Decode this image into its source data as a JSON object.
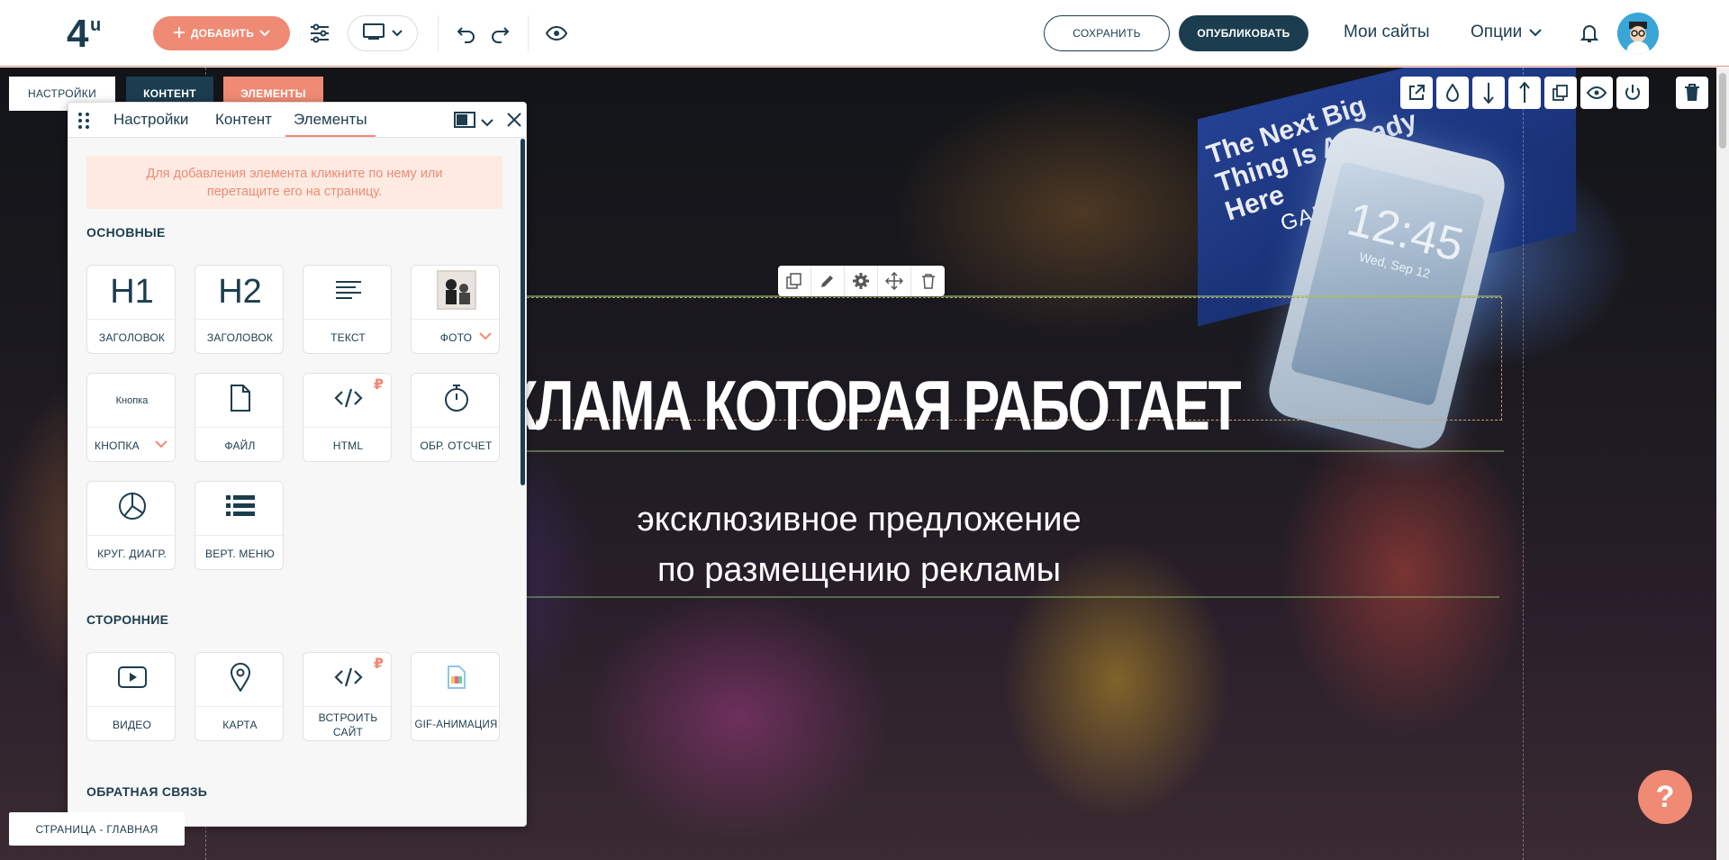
{
  "topbar": {
    "logo_text": "4u",
    "add_label": "ДОБАВИТЬ",
    "save_label": "СОХРАНИТЬ",
    "publish_label": "ОПУБЛИКОВАТЬ",
    "my_sites_label": "Мои сайты",
    "options_label": "Опции",
    "accent_color": "#ef8a74",
    "dark_color": "#1c3d4f"
  },
  "mini_tabs": {
    "settings": "НАСТРОЙКИ",
    "content": "КОНТЕНТ",
    "elements": "ЭЛЕМЕНТЫ"
  },
  "panel": {
    "tabs": [
      "Настройки",
      "Контент",
      "Элементы"
    ],
    "active_tab": "Элементы",
    "info_line1": "Для добавления элемента кликните по нему или",
    "info_line2": "перетащите его на страницу.",
    "sections": {
      "basic": "ОСНОВНЫЕ",
      "third_party": "СТОРОННИЕ",
      "feedback": "ОБРАТНАЯ СВЯЗЬ"
    },
    "basic_items": [
      {
        "icon": "h1-icon",
        "icon_text": "H1",
        "label": "ЗАГОЛОВОК"
      },
      {
        "icon": "h2-icon",
        "icon_text": "H2",
        "label": "ЗАГОЛОВОК"
      },
      {
        "icon": "text-lines-icon",
        "label": "ТЕКСТ"
      },
      {
        "icon": "photo-thumbnail-icon",
        "label": "ФОТО",
        "has_dropdown": true
      },
      {
        "icon": "button-sample-icon",
        "icon_text": "Кнопка",
        "label": "КНОПКА",
        "has_dropdown": true
      },
      {
        "icon": "file-icon",
        "label": "ФАЙЛ"
      },
      {
        "icon": "code-icon",
        "label": "HTML",
        "paid_badge": "₽"
      },
      {
        "icon": "timer-icon",
        "label": "ОБР. ОТСЧЕТ"
      },
      {
        "icon": "pie-chart-icon",
        "label": "КРУГ. ДИАГР."
      },
      {
        "icon": "list-icon",
        "label": "ВЕРТ. МЕНЮ"
      }
    ],
    "third_party_items": [
      {
        "icon": "video-icon",
        "label": "ВИДЕО"
      },
      {
        "icon": "map-pin-icon",
        "label": "КАРТА"
      },
      {
        "icon": "code-icon",
        "label_line1": "ВСТРОИТЬ",
        "label_line2": "САЙТ",
        "paid_badge": "₽"
      },
      {
        "icon": "gif-icon",
        "label": "GIF-АНИМАЦИЯ"
      }
    ]
  },
  "canvas": {
    "headline": "КЛАМА КОТОРАЯ РАБОТАЕТ",
    "subtitle_line1": "эксклюзивное предложение",
    "subtitle_line2": "по размещению рекламы",
    "billboard_text": "The Next Big Thing Is Already Here",
    "phone_brand": "GALAXY SIII",
    "phone_clock": "12:45",
    "phone_date": "Wed, Sep 12"
  },
  "footer": {
    "page_label": "СТРАНИЦА - ГЛАВНАЯ",
    "help_label": "?"
  }
}
